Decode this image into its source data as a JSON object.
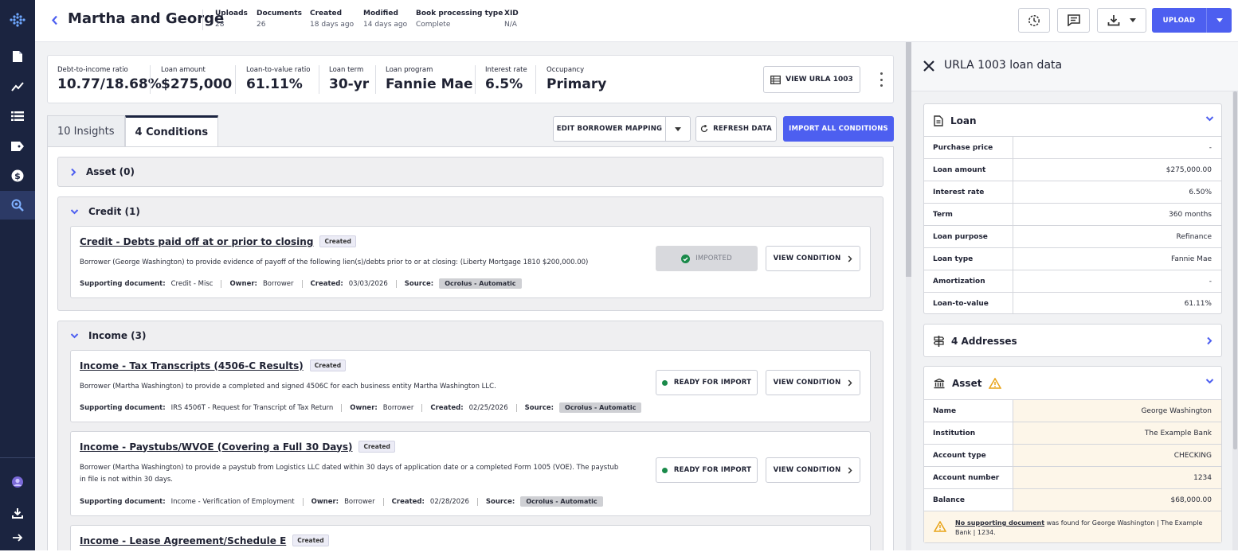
{
  "header": {
    "title": "Martha and George",
    "meta": [
      {
        "label": "Uploads",
        "value": "28"
      },
      {
        "label": "Documents",
        "value": "26"
      },
      {
        "label": "Created",
        "value": "18 days ago"
      },
      {
        "label": "Modified",
        "value": "14 days ago"
      },
      {
        "label": "Book processing type",
        "value": "Complete"
      },
      {
        "label": "XID",
        "value": "N/A"
      }
    ],
    "upload_label": "UPLOAD"
  },
  "sidebar": {
    "items": [
      "logo-icon",
      "document-icon",
      "chart-line-icon",
      "list-icon",
      "tag-icon",
      "dollar-icon",
      "search-icon"
    ],
    "bottom": [
      "user-icon",
      "download-icon",
      "arrow-right-icon"
    ],
    "active": "search-icon"
  },
  "metrics": [
    {
      "label": "Debt-to-income ratio",
      "value": "10.77/18.68%"
    },
    {
      "label": "Loan amount",
      "value": "$275,000"
    },
    {
      "label": "Loan-to-value ratio",
      "value": "61.11%"
    },
    {
      "label": "Loan term",
      "value": "30-yr"
    },
    {
      "label": "Loan program",
      "value": "Fannie Mae"
    },
    {
      "label": "Interest rate",
      "value": "6.5%"
    },
    {
      "label": "Occupancy",
      "value": "Primary"
    }
  ],
  "view_urla_label": "VIEW URLA 1003",
  "tabs": [
    {
      "label": "10 Insights"
    },
    {
      "label": "4 Conditions"
    }
  ],
  "toolbar": {
    "edit_mapping": "EDIT BORROWER MAPPING",
    "refresh": "REFRESH DATA",
    "import_all": "IMPORT ALL CONDITIONS"
  },
  "groups": [
    {
      "label": "Asset (0)",
      "expanded": false
    },
    {
      "label": "Credit (1)",
      "expanded": true
    },
    {
      "label": "Income (3)",
      "expanded": true
    }
  ],
  "labels": {
    "supporting": "Supporting document:",
    "owner": "Owner:",
    "created": "Created:",
    "source": "Source:",
    "view_condition": "VIEW CONDITION",
    "imported": "IMPORTED",
    "ready": "READY FOR IMPORT"
  },
  "conditions": [
    {
      "title": "Credit - Debts paid off at or prior to closing",
      "badge": "Created",
      "desc": "Borrower (George Washington) to provide evidence of payoff of the following lien(s)/debts prior to or at closing: (Liberty Mortgage 1810 $200,000.00)",
      "supporting": "Credit - Misc",
      "owner": "Borrower",
      "created": "03/03/2026",
      "source": "Ocrolus - Automatic",
      "status": "IMPORTED"
    },
    {
      "title": "Income - Tax Transcripts (4506-C Results)",
      "badge": "Created",
      "desc": "Borrower (Martha Washington) to provide a completed and signed 4506C for each business entity Martha Washington LLC.",
      "supporting": "IRS 4506T - Request for Transcript of Tax Return",
      "owner": "Borrower",
      "created": "02/25/2026",
      "source": "Ocrolus - Automatic",
      "status": "READY FOR IMPORT"
    },
    {
      "title": "Income - Paystubs/WVOE (Covering a Full 30 Days)",
      "badge": "Created",
      "desc": "Borrower (Martha Washington) to provide a paystub from Logistics LLC dated within 30 days of application date or a completed Form 1005 (VOE). The paystub in file is not within 30 days.",
      "supporting": "Income - Verification of Employment",
      "owner": "Borrower",
      "created": "02/28/2026",
      "source": "Ocrolus - Automatic",
      "status": "READY FOR IMPORT"
    },
    {
      "title": "Income - Lease Agreement/Schedule E",
      "badge": "Created"
    }
  ],
  "right_panel": {
    "title": "URLA 1003 loan data",
    "loan": {
      "label": "Loan",
      "rows": [
        {
          "k": "Purchase price",
          "v": "-"
        },
        {
          "k": "Loan amount",
          "v": "$275,000.00"
        },
        {
          "k": "Interest rate",
          "v": "6.50%"
        },
        {
          "k": "Term",
          "v": "360 months"
        },
        {
          "k": "Loan purpose",
          "v": "Refinance"
        },
        {
          "k": "Loan type",
          "v": "Fannie Mae"
        },
        {
          "k": "Amortization",
          "v": "-"
        },
        {
          "k": "Loan-to-value",
          "v": "61.11%"
        }
      ]
    },
    "addresses": {
      "label": "4 Addresses"
    },
    "asset": {
      "label": "Asset",
      "rows": [
        {
          "k": "Name",
          "v": "George Washington"
        },
        {
          "k": "Institution",
          "v": "The Example Bank"
        },
        {
          "k": "Account type",
          "v": "CHECKING"
        },
        {
          "k": "Account number",
          "v": "1234"
        },
        {
          "k": "Balance",
          "v": "$68,000.00"
        }
      ],
      "warning_link": "No supporting document",
      "warning_text": " was found for George Washington | The Example Bank | 1234."
    }
  },
  "colors": {
    "accent": "#4d5ff0",
    "sidebar": "#1b2440",
    "success": "#1a8a4a",
    "warning": "#e8a317"
  }
}
